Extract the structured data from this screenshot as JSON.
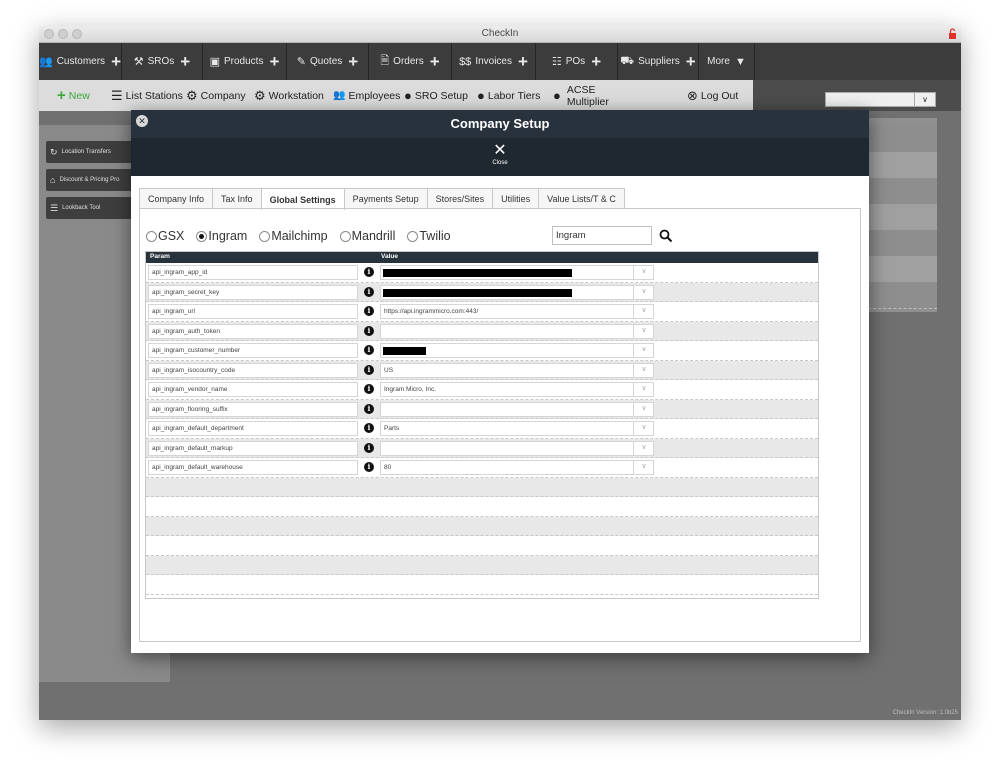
{
  "window": {
    "title": "CheckIn",
    "version": "CheckIn Version: 1.0b25"
  },
  "topnav": {
    "items": [
      {
        "label": "Customers",
        "icon": "users-icon",
        "has_plus": true
      },
      {
        "label": "SROs",
        "icon": "tools-icon",
        "has_plus": true
      },
      {
        "label": "Products",
        "icon": "box-icon",
        "has_plus": true
      },
      {
        "label": "Quotes",
        "icon": "edit-icon",
        "has_plus": true
      },
      {
        "label": "Orders",
        "icon": "document-icon",
        "has_plus": true
      },
      {
        "label": "Invoices",
        "icon": "dollar-icon",
        "has_plus": true
      },
      {
        "label": "POs",
        "icon": "list-icon",
        "has_plus": true
      },
      {
        "label": "Suppliers",
        "icon": "truck-icon",
        "has_plus": true
      },
      {
        "label": "More",
        "icon": "caret-down-icon",
        "has_plus": false
      }
    ]
  },
  "toolbar": {
    "new_label": "New",
    "list_stations_label": "List Stations",
    "company_label": "Company",
    "workstation_label": "Workstation",
    "employees_label": "Employees",
    "sro_setup_label": "SRO Setup",
    "labor_tiers_label": "Labor Tiers",
    "acse_multiplier_label_1": "ACSE",
    "acse_multiplier_label_2": "Multiplier",
    "logout_label": "Log Out",
    "accent_color": "#3aa83a"
  },
  "sidebar": {
    "buttons": [
      {
        "label": "Location Transfers",
        "icon": "refresh-icon"
      },
      {
        "label": "Discount & Pricing Pro",
        "icon": "building-icon"
      },
      {
        "label": "Lookback Tool",
        "icon": "list-icon"
      }
    ]
  },
  "modal": {
    "title": "Company Setup",
    "close_label": "Close",
    "header_color": "#28323d",
    "tabs": [
      {
        "label": "Company Info",
        "active": false
      },
      {
        "label": "Tax Info",
        "active": false
      },
      {
        "label": "Global Settings",
        "active": true
      },
      {
        "label": "Payments Setup",
        "active": false
      },
      {
        "label": "Stores/Sites",
        "active": false
      },
      {
        "label": "Utilities",
        "active": false
      },
      {
        "label": "Value Lists/T & C",
        "active": false
      }
    ],
    "radios": [
      {
        "label": "GSX",
        "checked": false
      },
      {
        "label": "Ingram",
        "checked": true
      },
      {
        "label": "Mailchimp",
        "checked": false
      },
      {
        "label": "Mandrill",
        "checked": false
      },
      {
        "label": "Twilio",
        "checked": false
      }
    ],
    "search_value": "Ingram",
    "grid": {
      "col_param": "Param",
      "col_value": "Value",
      "rows": [
        {
          "param": "api_ingram_app_id",
          "value": "",
          "redacted": true,
          "redact_frac": 0.7
        },
        {
          "param": "api_ingram_secret_key",
          "value": "",
          "redacted": true,
          "redact_frac": 0.7
        },
        {
          "param": "api_ingram_url",
          "value": "https://api.ingrammicro.com:443/",
          "redacted": false
        },
        {
          "param": "api_ingram_auth_token",
          "value": "",
          "redacted": false
        },
        {
          "param": "api_ingram_customer_number",
          "value": "",
          "redacted": true,
          "redact_frac": 0.16
        },
        {
          "param": "api_ingram_isocountry_code",
          "value": "US",
          "redacted": false
        },
        {
          "param": "api_ingram_vendor_name",
          "value": "Ingram Micro, Inc.",
          "redacted": false
        },
        {
          "param": "api_ingram_flooring_suffix",
          "value": "",
          "redacted": false
        },
        {
          "param": "api_ingram_default_department",
          "value": "Parts",
          "redacted": false
        },
        {
          "param": "api_ingram_default_markup",
          "value": "",
          "redacted": false
        },
        {
          "param": "api_ingram_default_warehouse",
          "value": "80",
          "redacted": false
        }
      ],
      "empty_rows": 6
    }
  }
}
